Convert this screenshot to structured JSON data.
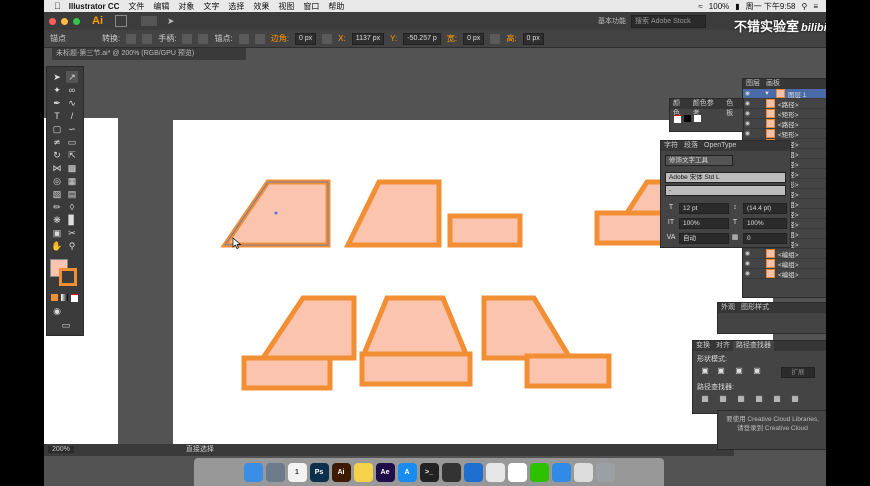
{
  "menubar": {
    "app": "Illustrator CC",
    "items": [
      "文件",
      "编辑",
      "对象",
      "文字",
      "选择",
      "效果",
      "视图",
      "窗口",
      "帮助"
    ],
    "battery": "100%",
    "clock": "周一 下午9:58"
  },
  "appbar": {
    "logo": "Ai",
    "workspace": "基本功能",
    "search_placeholder": "搜索 Adobe Stock"
  },
  "controlbar": {
    "anchor_label": "锚点",
    "convert_label": "转换:",
    "handle_label": "手柄:",
    "anchor2_label": "锚点:",
    "corner_label": "边角:",
    "corner_value": "0 px",
    "x_label": "X:",
    "x_value": "1137 px",
    "y_label": "Y:",
    "y_value": "-50.257 p",
    "w_label": "宽:",
    "w_value": "0 px",
    "h_label": "高:",
    "h_value": "0 px"
  },
  "doctab": {
    "title": "未标题-第三节.ai* @ 200% (RGB/GPU 预览)"
  },
  "statusbar": {
    "zoom": "200%",
    "tool": "直接选择"
  },
  "layers_panel": {
    "tabs": [
      "图层",
      "画板"
    ],
    "top_layer": "图层 1",
    "items": [
      "<路径>",
      "<矩形>",
      "<路径>",
      "<矩形>",
      "<路径>",
      "<编组>",
      "<路径>",
      "<路径>",
      "<矩形>",
      "<路径>",
      "<编组>",
      "<路径>",
      "<路径>",
      "<编组>",
      "<路径>",
      "<编组>",
      "<编组>",
      "<编组>"
    ]
  },
  "color_panel": {
    "tabs": [
      "颜色",
      "颜色参考",
      "色板"
    ]
  },
  "char_panel": {
    "tabs": [
      "字符",
      "段落",
      "OpenType"
    ],
    "touch_type": "修饰文字工具",
    "font": "Adobe 宋体 Std L",
    "style": "-",
    "size": "12 pt",
    "leading": "(14.4 pt)",
    "scale_v": "100%",
    "scale_h": "100%",
    "kerning": "自动",
    "tracking": "0"
  },
  "appearance_panel": {
    "tabs": [
      "外观",
      "图形样式"
    ]
  },
  "pathfinder_panel": {
    "tabs": [
      "变换",
      "对齐",
      "路径查找器"
    ],
    "shape_modes": "形状模式:",
    "expand": "扩展",
    "pathfinders": "路径查找器:"
  },
  "cc_libraries": {
    "line1": "要使用 Creative Cloud Libraries,",
    "line2": "请登录到 Creative Cloud"
  },
  "dock": {
    "icons": [
      {
        "name": "finder-icon",
        "label": "",
        "color": "#3a8ee6"
      },
      {
        "name": "launchpad-icon",
        "label": "",
        "color": "#6c7a89"
      },
      {
        "name": "calendar-icon",
        "label": "1",
        "color": "#f2f2f2"
      },
      {
        "name": "photoshop-icon",
        "label": "Ps",
        "color": "#0c2f4c"
      },
      {
        "name": "illustrator-icon",
        "label": "Ai",
        "color": "#3d1b00"
      },
      {
        "name": "notes-icon",
        "label": "",
        "color": "#f4d24a"
      },
      {
        "name": "aftereffects-icon",
        "label": "Ae",
        "color": "#1e0f4a"
      },
      {
        "name": "appstore-icon",
        "label": "A",
        "color": "#1a8cf0"
      },
      {
        "name": "terminal-icon",
        "label": ">_",
        "color": "#222"
      },
      {
        "name": "unity-icon",
        "label": "",
        "color": "#333"
      },
      {
        "name": "quicktime-icon",
        "label": "",
        "color": "#1f6fd1"
      },
      {
        "name": "chrome-icon",
        "label": "",
        "color": "#e6e6e6"
      },
      {
        "name": "qq-icon",
        "label": "",
        "color": "#ffffff"
      },
      {
        "name": "wechat-icon",
        "label": "",
        "color": "#2dc100"
      },
      {
        "name": "safari-icon",
        "label": "",
        "color": "#2f8ae8"
      },
      {
        "name": "preview-icon",
        "label": "",
        "color": "#dcdcdc"
      },
      {
        "name": "trash-icon",
        "label": "",
        "color": "#9aa0a6"
      }
    ]
  },
  "watermark": {
    "text": "不错实验室",
    "logo": "bilibili"
  },
  "colors": {
    "fill": "#fbc4ae",
    "stroke": "#f28e33",
    "selection": "#4a7bd8"
  }
}
